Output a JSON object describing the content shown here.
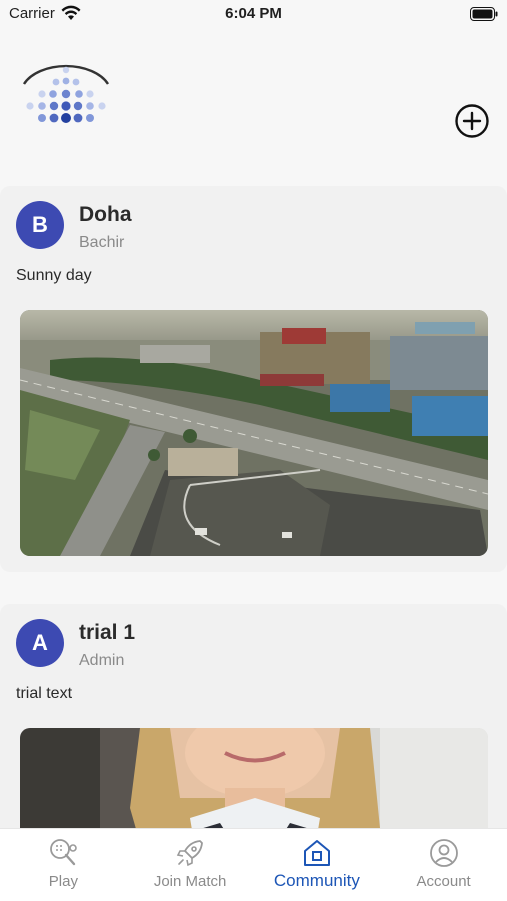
{
  "status_bar": {
    "carrier": "Carrier",
    "time": "6:04 PM"
  },
  "header": {
    "logo": "app-logo",
    "add_icon": "plus-circle-icon"
  },
  "posts": [
    {
      "avatar_letter": "B",
      "title": "Doha",
      "subtitle": "Bachir",
      "text": "Sunny day",
      "image": "aerial-city-photo"
    },
    {
      "avatar_letter": "A",
      "title": "trial 1",
      "subtitle": "Admin",
      "text": "trial text",
      "image": "portrait-photo"
    }
  ],
  "tabs": [
    {
      "label": "Play",
      "icon": "padel-racket-icon",
      "active": false
    },
    {
      "label": "Join Match",
      "icon": "rocket-icon",
      "active": false
    },
    {
      "label": "Community",
      "icon": "home-icon",
      "active": true
    },
    {
      "label": "Account",
      "icon": "user-circle-icon",
      "active": false
    }
  ],
  "colors": {
    "accent": "#1d56b6",
    "avatar": "#3d4ab2",
    "inactive": "#8a8a8a"
  }
}
